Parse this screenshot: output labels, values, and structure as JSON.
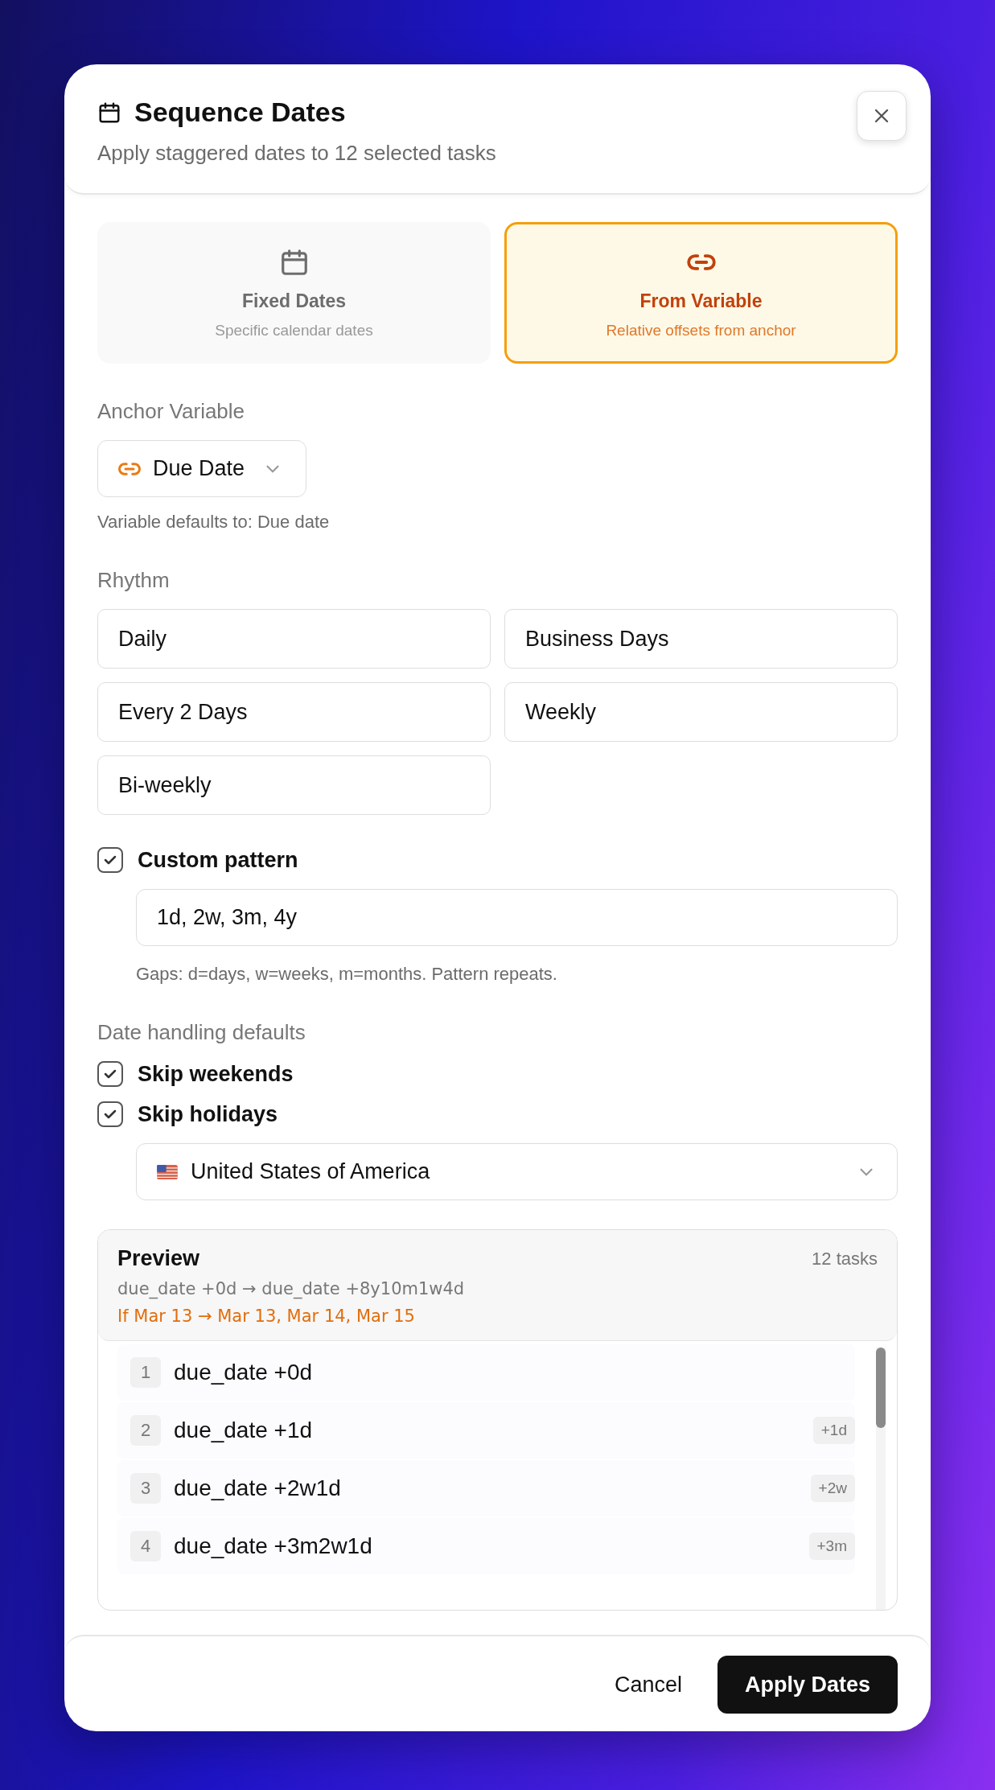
{
  "dialog": {
    "title": "Sequence Dates",
    "subtitle": "Apply staggered dates to 12 selected tasks"
  },
  "modes": [
    {
      "kind": "calendar",
      "label": "Fixed Dates",
      "description": "Specific calendar dates",
      "selected": false
    },
    {
      "kind": "link",
      "label": "From Variable",
      "description": "Relative offsets from anchor",
      "selected": true
    }
  ],
  "anchor": {
    "label": "Anchor Variable",
    "value": "Due Date",
    "hint": "Variable defaults to: Due date"
  },
  "rhythm": {
    "label": "Rhythm",
    "options": [
      {
        "label": "Daily",
        "selected": false
      },
      {
        "label": "Business Days",
        "selected": false
      },
      {
        "label": "Every 2 Days",
        "selected": false
      },
      {
        "label": "Weekly",
        "selected": false
      },
      {
        "label": "Bi-weekly",
        "selected": false
      }
    ]
  },
  "custom_pattern": {
    "label": "Custom pattern",
    "checked": true,
    "value": "1d, 2w, 3m, 4y",
    "hint": "Gaps: d=days, w=weeks, m=months. Pattern repeats."
  },
  "date_handling": {
    "label": "Date handling defaults",
    "options": [
      {
        "label": "Skip weekends",
        "checked": true
      },
      {
        "label": "Skip holidays",
        "checked": true
      }
    ],
    "country": "United States of America"
  },
  "preview": {
    "title": "Preview",
    "count": "12 tasks",
    "range": "due_date +0d → due_date +8y10m1w4d",
    "example": "If Mar 13 → Mar 13, Mar 14, Mar 15",
    "rows": [
      {
        "index": "1",
        "expression": "due_date +0d"
      },
      {
        "index": "2",
        "expression": "due_date +1d",
        "offset": "+1d"
      },
      {
        "index": "3",
        "expression": "due_date +2w1d",
        "offset": "+2w"
      },
      {
        "index": "4",
        "expression": "due_date +3m2w1d",
        "offset": "+3m"
      }
    ]
  },
  "buttons": {
    "cancel": "Cancel",
    "apply": "Apply Dates"
  }
}
